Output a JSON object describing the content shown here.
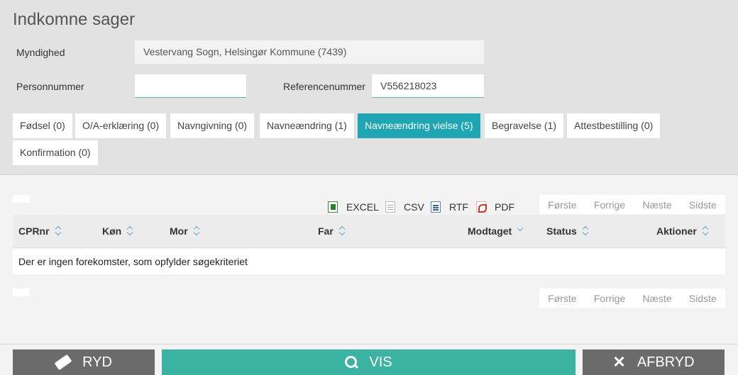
{
  "page": {
    "title": "Indkomne sager"
  },
  "form": {
    "myndighed_label": "Myndighed",
    "myndighed_value": "Vestervang Sogn, Helsingør Kommune (7439)",
    "personnummer_label": "Personnummer",
    "personnummer_value": "",
    "referencenummer_label": "Referencenummer",
    "referencenummer_value": "V556218023"
  },
  "tabs": [
    {
      "label": "Fødsel (0)",
      "active": false
    },
    {
      "label": "O/A-erklæring (0)",
      "active": false
    },
    {
      "label": "Navngivning (0)",
      "active": false
    },
    {
      "label": "Navneændring (1)",
      "active": false
    },
    {
      "label": "Navneændring vielse (5)",
      "active": true
    },
    {
      "label": "Begravelse (1)",
      "active": false
    },
    {
      "label": "Attestbestilling (0)",
      "active": false
    },
    {
      "label": "Konfirmation (0)",
      "active": false
    }
  ],
  "exports": [
    {
      "label": "EXCEL",
      "icon": "excel-icon"
    },
    {
      "label": "CSV",
      "icon": "csv-icon"
    },
    {
      "label": "RTF",
      "icon": "rtf-icon"
    },
    {
      "label": "PDF",
      "icon": "pdf-icon"
    }
  ],
  "pager": {
    "first": "Første",
    "prev": "Forrige",
    "next": "Næste",
    "last": "Sidste"
  },
  "table": {
    "columns": [
      "CPRnr",
      "Køn",
      "Mor",
      "Far",
      "Modtaget",
      "Status",
      "Aktioner"
    ],
    "empty_message": "Der er ingen forekomster, som opfylder søgekriteriet"
  },
  "buttons": {
    "clear": "RYD",
    "show": "VIS",
    "cancel": "AFBRYD"
  },
  "colors": {
    "accent": "#1ea6b4",
    "primary_button": "#3bb3a2",
    "secondary_button": "#6b6b6b"
  }
}
